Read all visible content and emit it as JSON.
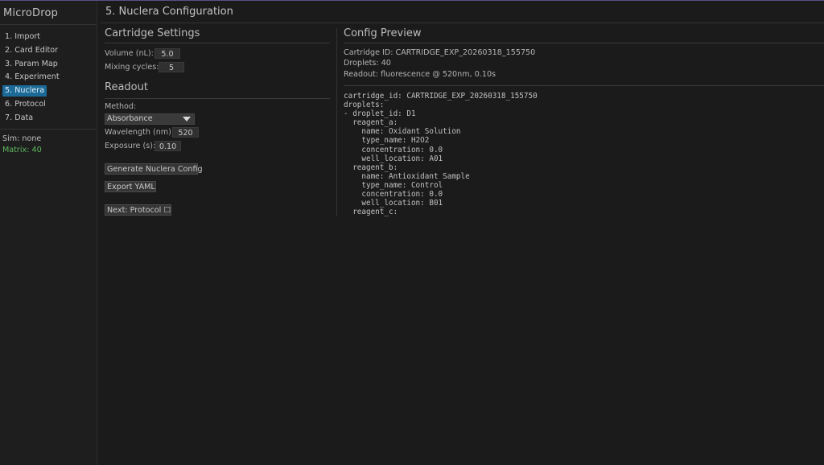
{
  "app": {
    "title": "MicroDrop"
  },
  "sidebar": {
    "items": [
      {
        "label": "1. Import",
        "active": false
      },
      {
        "label": "2. Card Editor",
        "active": false
      },
      {
        "label": "3. Param Map",
        "active": false
      },
      {
        "label": "4. Experiment",
        "active": false
      },
      {
        "label": "5. Nuclera",
        "active": true
      },
      {
        "label": "6. Protocol",
        "active": false
      },
      {
        "label": "7. Data",
        "active": false
      }
    ],
    "sim": "Sim: none",
    "matrix": "Matrix: 40",
    "accent_color": "#1c6a98",
    "matrix_color": "#5fb85f"
  },
  "page": {
    "title": "5. Nuclera Configuration"
  },
  "cartridge": {
    "heading": "Cartridge Settings",
    "volume_label": "Volume (nL):",
    "volume_value": "5.0",
    "mixing_label": "Mixing cycles:",
    "mixing_value": "5"
  },
  "readout": {
    "heading": "Readout",
    "method_label": "Method:",
    "method_value": "Absorbance",
    "wavelength_label": "Wavelength (nm):",
    "wavelength_value": "520",
    "exposure_label": "Exposure (s):",
    "exposure_value": "0.10"
  },
  "buttons": {
    "generate": "Generate Nuclera Config",
    "export": "Export YAML",
    "next": "Next: Protocol ☐"
  },
  "preview": {
    "heading": "Config Preview",
    "cartridge_id": "Cartridge ID: CARTRIDGE_EXP_20260318_155750",
    "droplets": "Droplets: 40",
    "readout": "Readout: fluorescence @ 520nm, 0.10s",
    "yaml": "cartridge_id: CARTRIDGE_EXP_20260318_155750\ndroplets:\n- droplet_id: D1\n  reagent_a:\n    name: Oxidant Solution\n    type_name: H2O2\n    concentration: 0.0\n    well_location: A01\n  reagent_b:\n    name: Antioxidant Sample\n    type_name: Control\n    concentration: 0.0\n    well_location: B01\n  reagent_c:"
  }
}
